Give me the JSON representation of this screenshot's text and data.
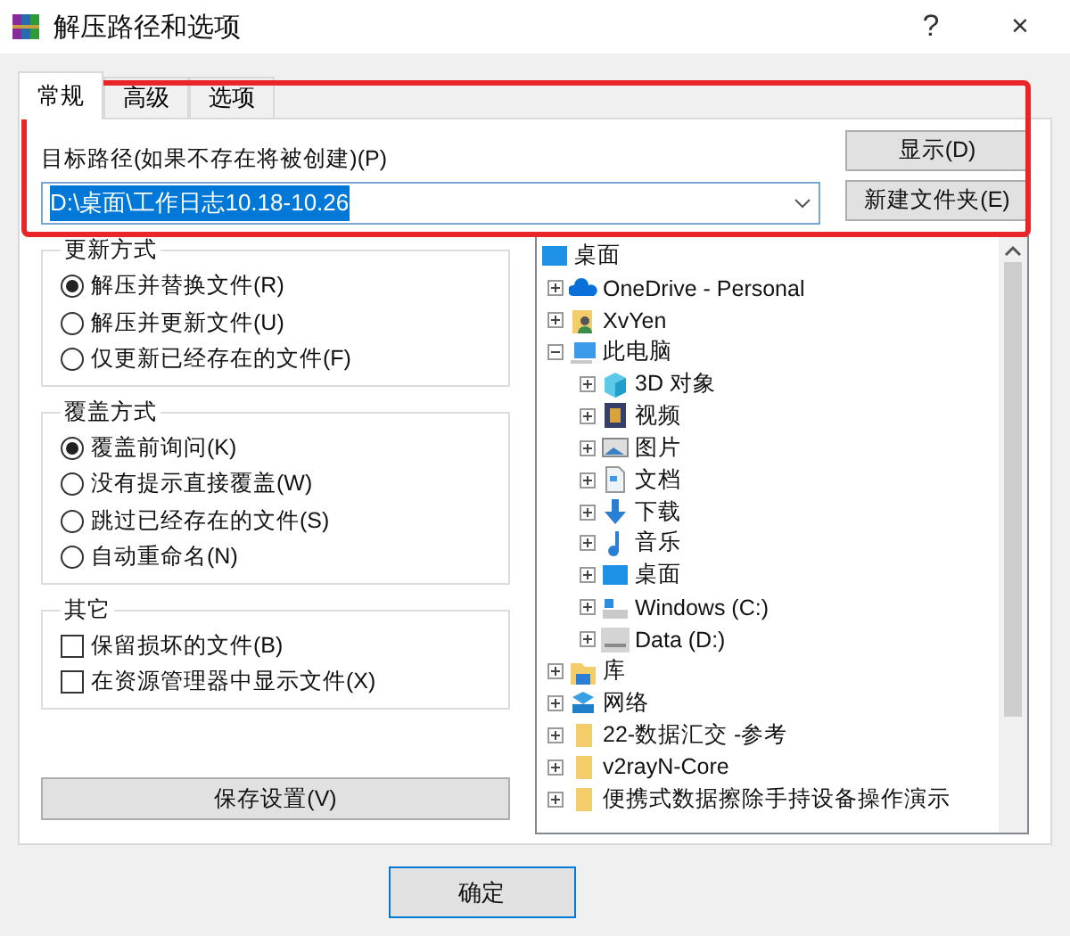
{
  "window": {
    "title": "解压路径和选项",
    "help": "?",
    "close": "×"
  },
  "tabs": [
    {
      "label": "常规",
      "selected": true
    },
    {
      "label": "高级",
      "selected": false
    },
    {
      "label": "选项",
      "selected": false
    }
  ],
  "path": {
    "label": "目标路径(如果不存在将被创建)(P)",
    "value": "D:\\桌面\\工作日志10.18-10.26",
    "text_selected": true
  },
  "side_buttons": [
    "显示(D)",
    "新建文件夹(E)"
  ],
  "groups": [
    {
      "title": "更新方式",
      "kind": "radio",
      "options": [
        {
          "label": "解压并替换文件(R)",
          "selected": true
        },
        {
          "label": "解压并更新文件(U)",
          "selected": false
        },
        {
          "label": "仅更新已经存在的文件(F)",
          "selected": false
        }
      ]
    },
    {
      "title": "覆盖方式",
      "kind": "radio",
      "options": [
        {
          "label": "覆盖前询问(K)",
          "selected": true
        },
        {
          "label": "没有提示直接覆盖(W)",
          "selected": false
        },
        {
          "label": "跳过已经存在的文件(S)",
          "selected": false
        },
        {
          "label": "自动重命名(N)",
          "selected": false
        }
      ]
    },
    {
      "title": "其它",
      "kind": "check",
      "options": [
        {
          "label": "保留损坏的文件(B)",
          "checked": false
        },
        {
          "label": "在资源管理器中显示文件(X)",
          "checked": false
        }
      ]
    }
  ],
  "save_button": "保存设置(V)",
  "tree": {
    "label": "桌面",
    "children": [
      {
        "label": "OneDrive - Personal",
        "expanded": false
      },
      {
        "label": "XvYen",
        "expanded": false
      },
      {
        "label": "此电脑",
        "expanded": true,
        "children": [
          {
            "label": "3D 对象",
            "expanded": false
          },
          {
            "label": "视频",
            "expanded": false
          },
          {
            "label": "图片",
            "expanded": false
          },
          {
            "label": "文档",
            "expanded": false
          },
          {
            "label": "下载",
            "expanded": false
          },
          {
            "label": "音乐",
            "expanded": false
          },
          {
            "label": "桌面",
            "expanded": false
          },
          {
            "label": "Windows (C:)",
            "expanded": false
          },
          {
            "label": "Data (D:)",
            "expanded": false
          }
        ]
      },
      {
        "label": "库",
        "expanded": false
      },
      {
        "label": "网络",
        "expanded": false
      },
      {
        "label": "22-数据汇交 -参考",
        "expanded": false
      },
      {
        "label": "v2rayN-Core",
        "expanded": false
      },
      {
        "label": "便携式数据擦除手持设备操作演示",
        "expanded": false
      }
    ]
  },
  "ok_button": "确定"
}
